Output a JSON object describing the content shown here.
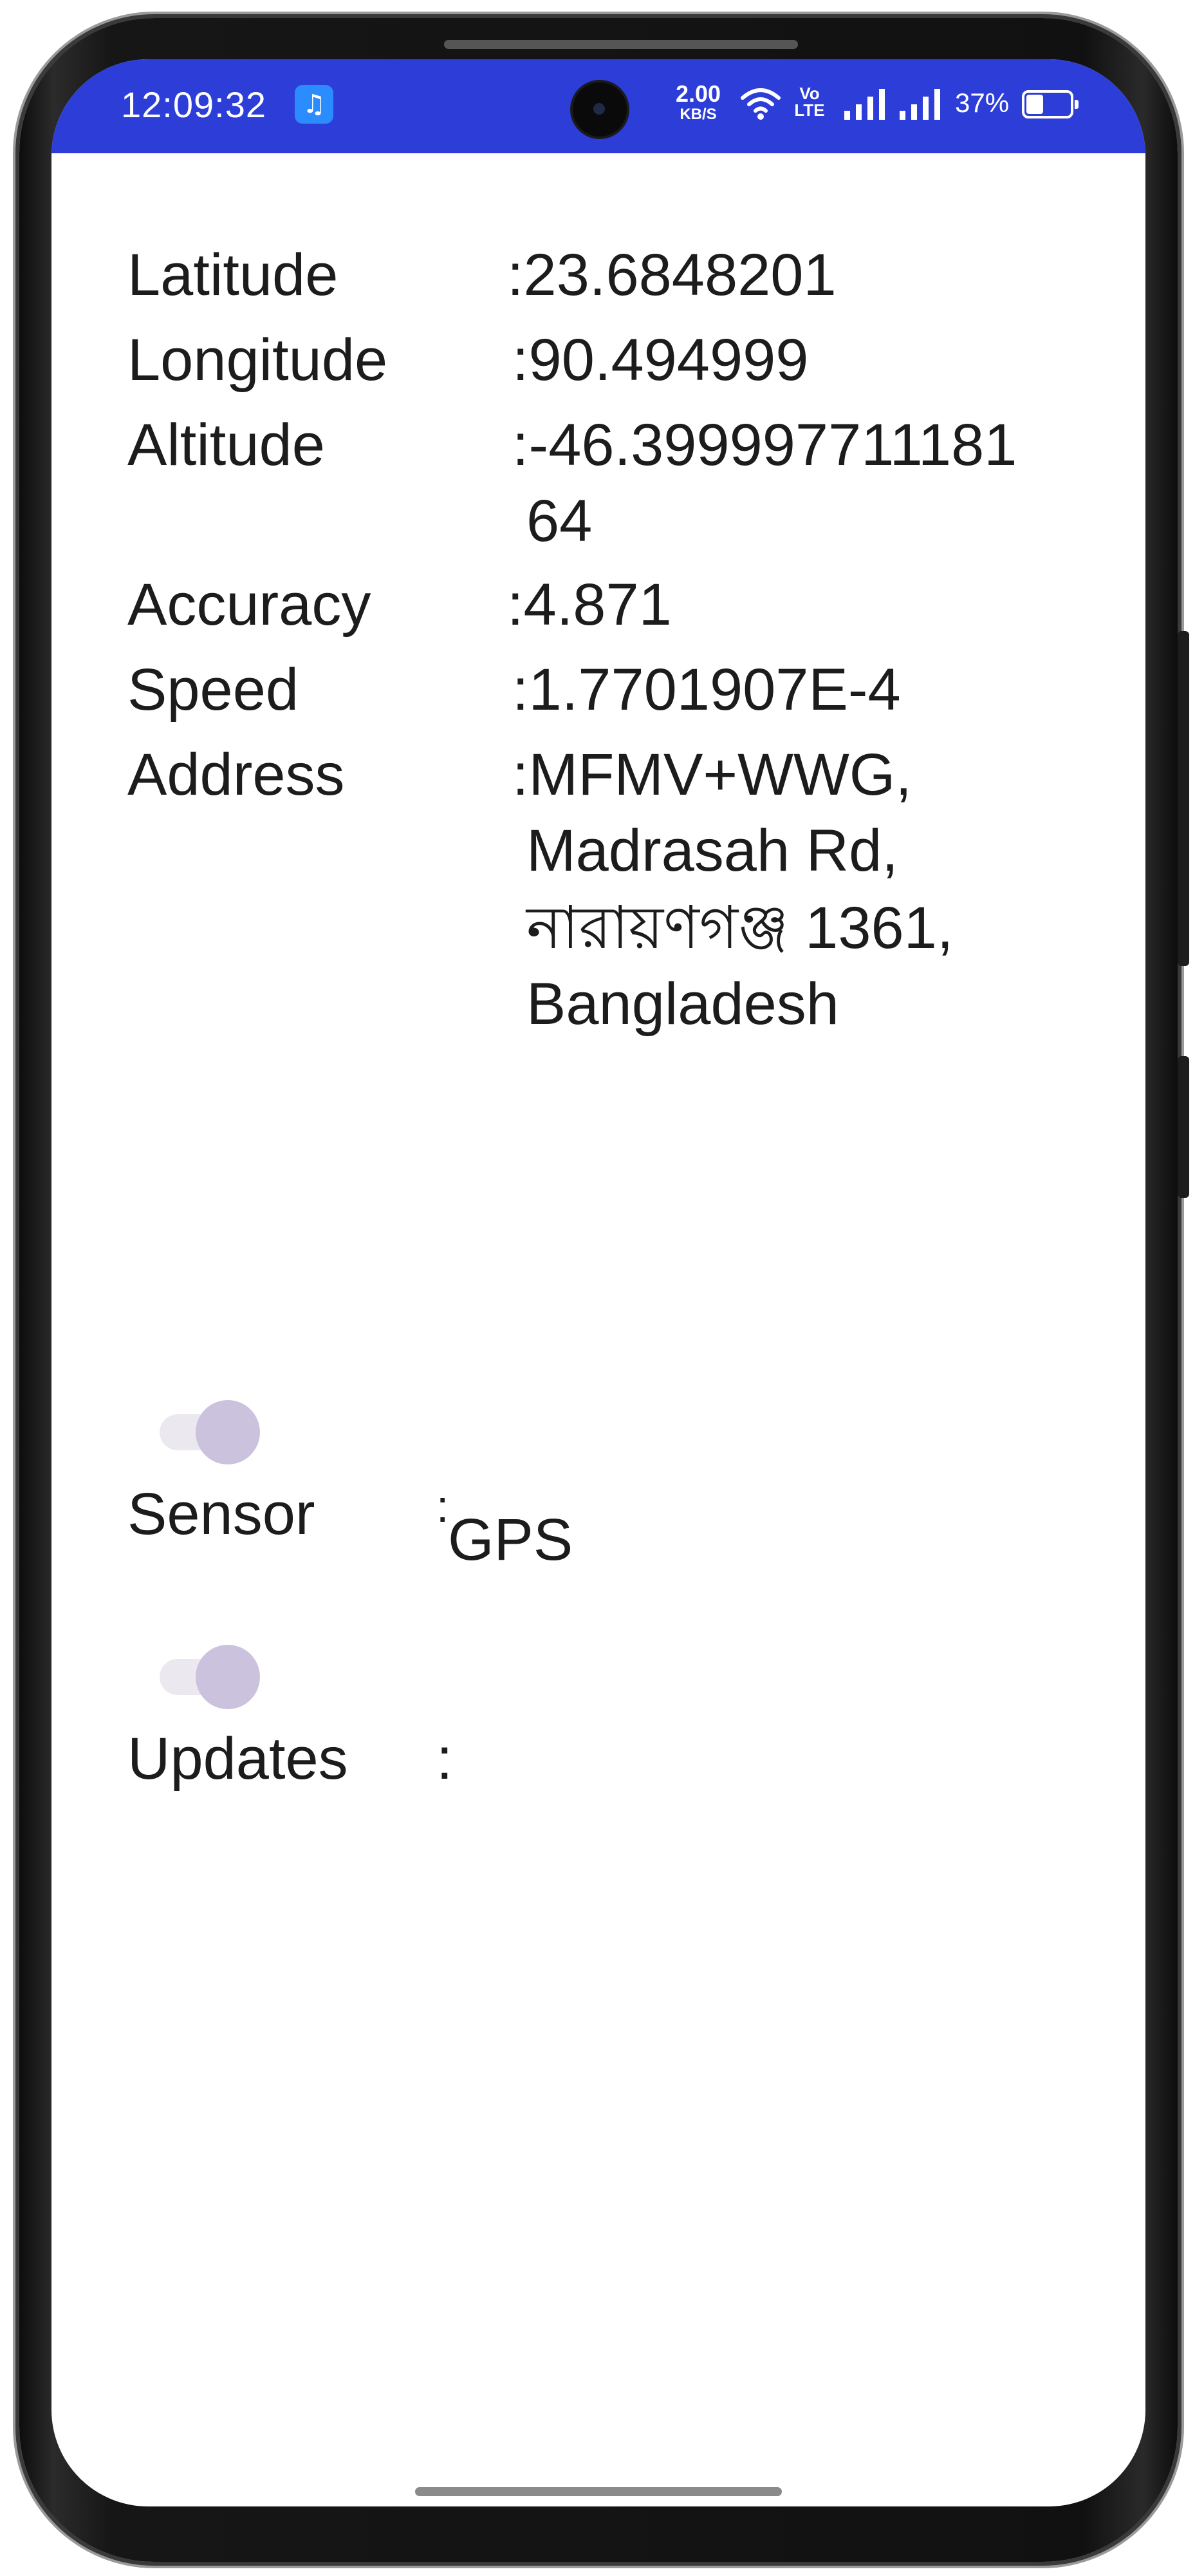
{
  "status_bar": {
    "time": "12:09:32",
    "net_speed_value": "2.00",
    "net_speed_unit": "KB/S",
    "volte_top": "Vo",
    "volte_bottom": "LTE",
    "battery_percent": "37%",
    "background_color": "#2d3ed8",
    "icons": [
      "music-icon",
      "camera",
      "wifi-icon",
      "volte-icon",
      "signal-icon",
      "signal-icon",
      "battery-icon"
    ]
  },
  "location": {
    "latitude_label": "Latitude",
    "latitude_value": ":23.6848201",
    "longitude_label": "Longitude",
    "longitude_value": ":90.494999",
    "altitude_label": "Altitude",
    "altitude_value_line1": ":-46.399997711181",
    "altitude_value_line2": "64",
    "accuracy_label": "Accuracy",
    "accuracy_value": ":4.871",
    "speed_label": "Speed",
    "speed_value": ":1.7701907E-4",
    "address_label": "Address",
    "address_line1": ":MFMV+WWG,",
    "address_line2": "Madrasah Rd,",
    "address_line3": "নারায়ণগঞ্জ 1361,",
    "address_line4": "Bangladesh"
  },
  "sensor": {
    "label": "Sensor",
    "colon": ":",
    "value": "GPS",
    "switch_on": true
  },
  "updates": {
    "label": "Updates",
    "colon": ":",
    "value": "",
    "switch_on": true
  }
}
